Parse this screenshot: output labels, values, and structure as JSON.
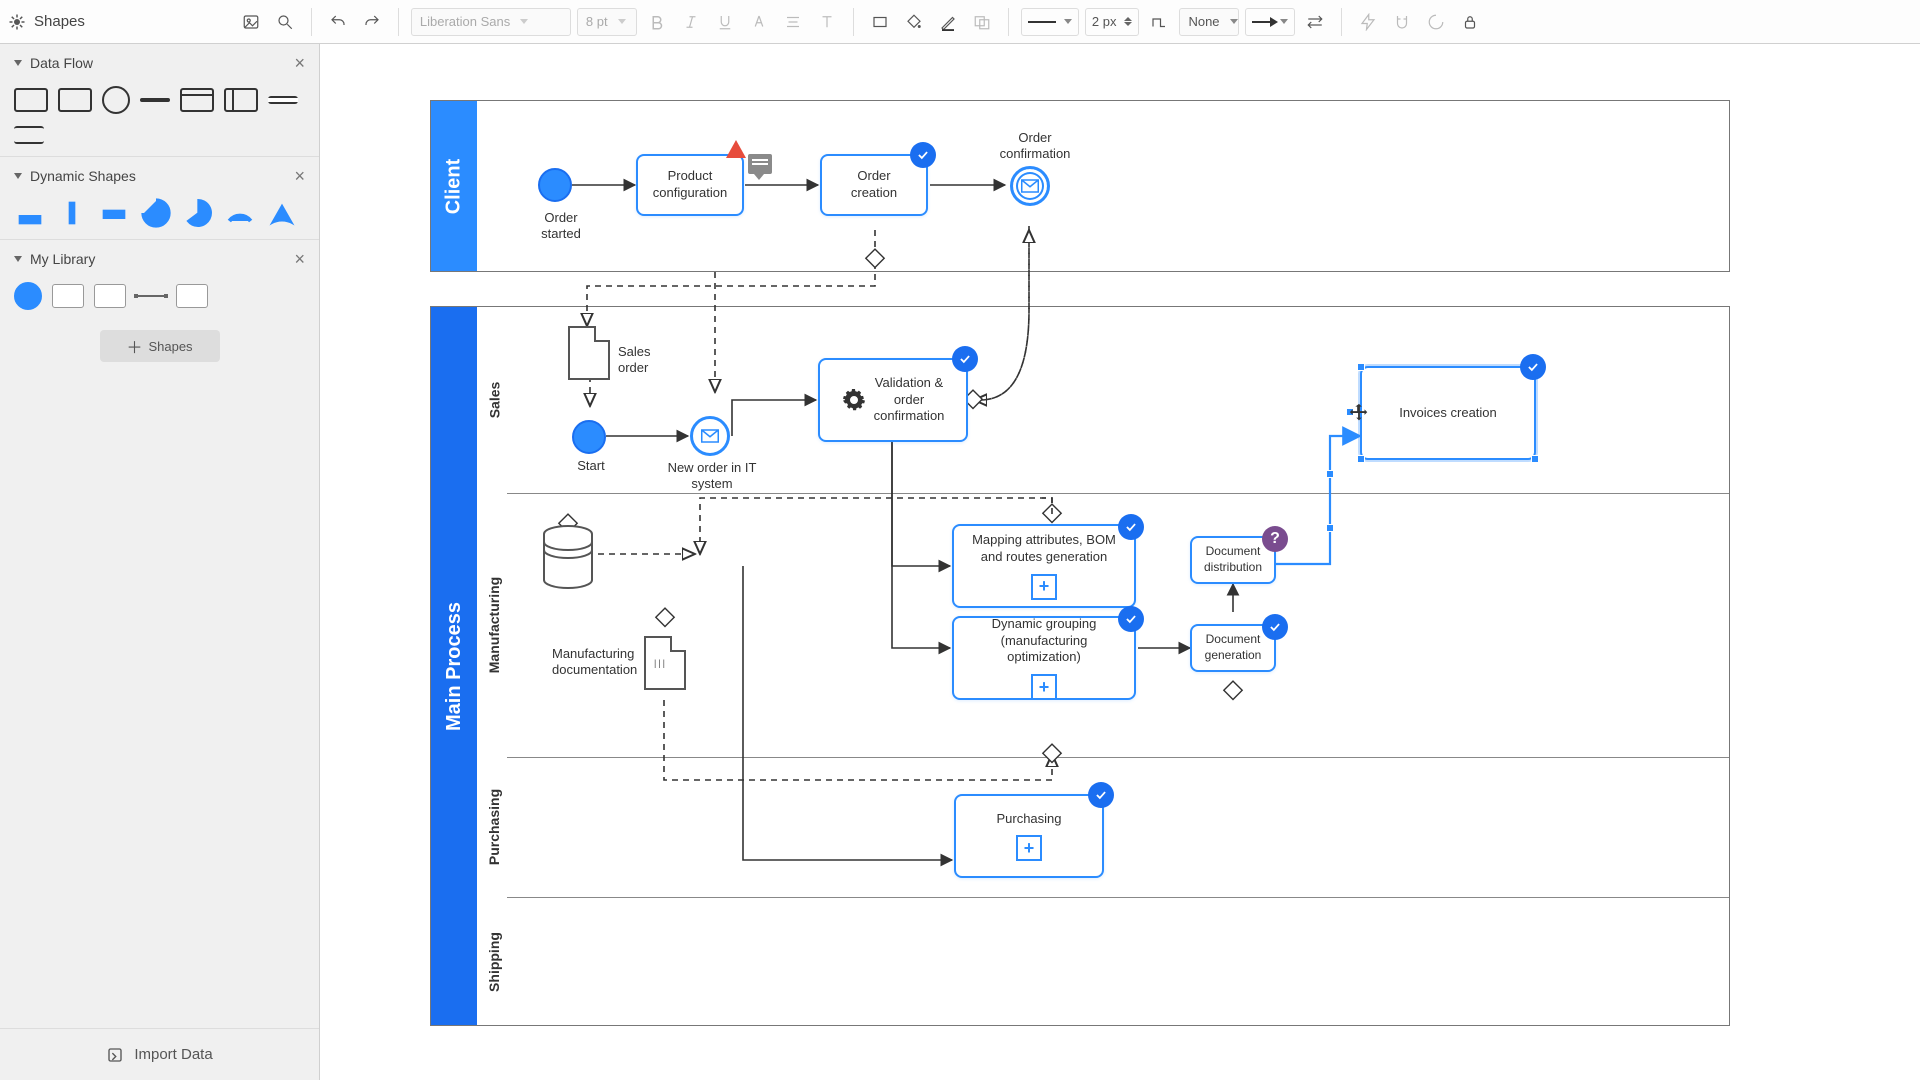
{
  "app": {
    "title": "Shapes",
    "font": "Liberation Sans",
    "font_size": "8 pt",
    "line_width": "2 px",
    "fill": "None"
  },
  "sidebar": {
    "panels": [
      {
        "title": "Data Flow"
      },
      {
        "title": "Dynamic Shapes"
      },
      {
        "title": "My Library"
      }
    ],
    "add_shapes": "Shapes",
    "import": "Import Data"
  },
  "pools": {
    "client": "Client",
    "main": "Main Process",
    "lanes": {
      "sales": "Sales",
      "mfg": "Manufacturing",
      "purch": "Purchasing",
      "ship": "Shipping"
    }
  },
  "nodes": {
    "order_started": "Order\nstarted",
    "product_config": "Product\nconfiguration",
    "order_creation": "Order creation",
    "order_confirmation": "Order\nconfirmation",
    "sales_order": "Sales\norder",
    "start": "Start",
    "new_order_it": "New order in IT\nsystem",
    "validation": "Validation &\norder\nconfirmation",
    "invoices": "Invoices creation",
    "mapping": "Mapping attributes, BOM\nand routes generation",
    "dyn_group": "Dynamic grouping\n(manufacturing optimization)",
    "doc_dist": "Document\ndistribution",
    "doc_gen": "Document\ngeneration",
    "mfg_doc": "Manufacturing\ndocumentation",
    "purchasing": "Purchasing"
  }
}
